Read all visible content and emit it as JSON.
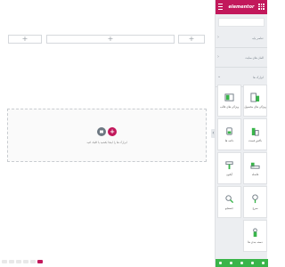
{
  "editor": {
    "logo_text": "elementor",
    "brand_color": "#c2185b",
    "accent_color": "#39b54a"
  },
  "canvas": {
    "structure_boxes": [
      {
        "plus": "+"
      },
      {
        "plus": "+"
      },
      {
        "plus": "+"
      }
    ],
    "drop_zone": {
      "text": "ابزارک ها را اینجا بکشید یا کلیک کنید",
      "add_icon": "+",
      "template_icon": "folder-icon"
    }
  },
  "panel": {
    "categories": [
      {
        "label": "عناصر پایه",
        "caret": "›"
      },
      {
        "label": "المان های سایت",
        "caret": "›"
      },
      {
        "label": "ابزارک ها",
        "caret": "⌄"
      }
    ],
    "widgets": [
      {
        "label": "ویژگی های قالب",
        "icon": "section-icon"
      },
      {
        "label": "ویژگی های محصول",
        "icon": "layout-icon"
      },
      {
        "label": "دکمه ها",
        "icon": "button-icon"
      },
      {
        "label": "باکس قیمت",
        "icon": "price-box-icon"
      },
      {
        "label": "آیکون",
        "icon": "toggle-icon"
      },
      {
        "label": "فاصله",
        "icon": "spacer-icon"
      },
      {
        "label": "جستجو",
        "icon": "search-icon"
      },
      {
        "label": "سرچ",
        "icon": "search-alt-icon"
      },
      {
        "label": "دسته بندی ها",
        "icon": "person-icon"
      }
    ]
  }
}
